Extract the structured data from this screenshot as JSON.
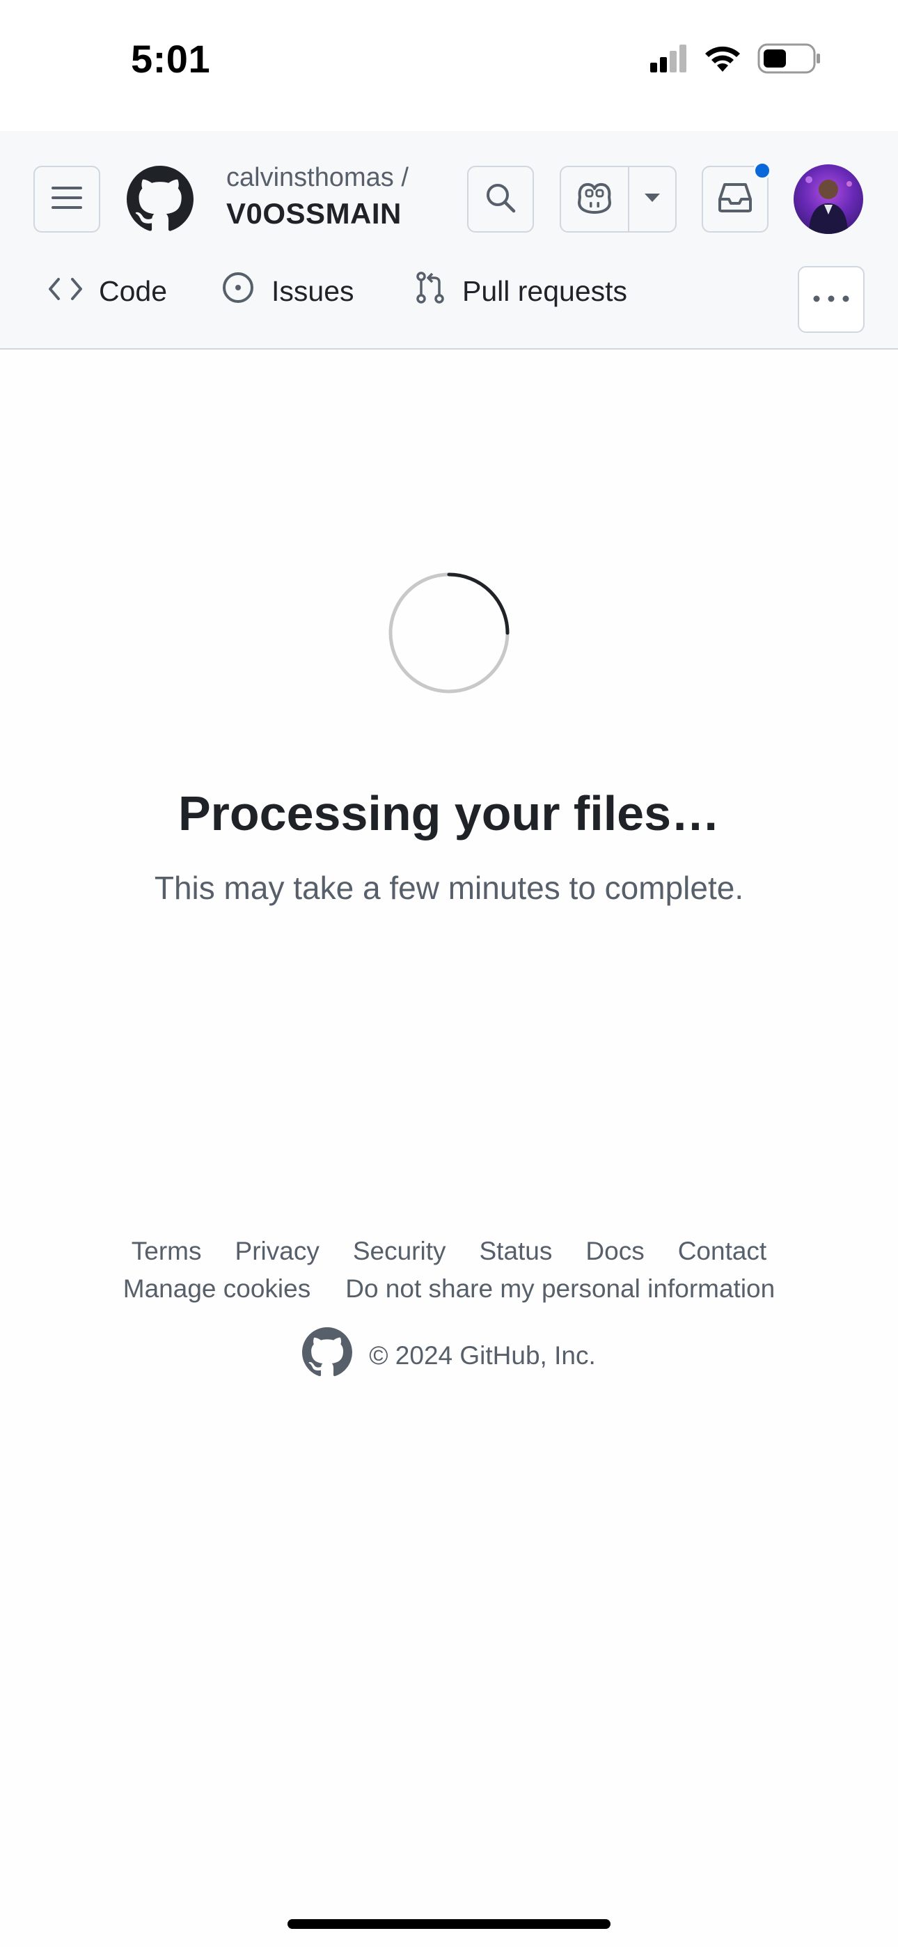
{
  "status_bar": {
    "time": "5:01",
    "icons": [
      "cellular-signal-icon",
      "wifi-icon",
      "battery-icon"
    ]
  },
  "header": {
    "owner": "calvinsthomas /",
    "repo": "V0OSSMAIN",
    "icons": [
      "hamburger-menu-icon",
      "github-logo-icon",
      "search-icon",
      "copilot-icon",
      "triangle-down-icon",
      "inbox-icon",
      "avatar"
    ],
    "notification_dot_color": "#0969da"
  },
  "nav": {
    "tabs": [
      {
        "label": "Code",
        "icon": "code-icon"
      },
      {
        "label": "Issues",
        "icon": "issue-opened-icon"
      },
      {
        "label": "Pull requests",
        "icon": "git-pull-request-icon"
      }
    ],
    "more_icon": "kebab-horizontal-icon"
  },
  "main": {
    "title": "Processing your files…",
    "subtitle": "This may take a few minutes to complete.",
    "spinner_icon": "loading-spinner-icon"
  },
  "footer": {
    "links_row1": [
      "Terms",
      "Privacy",
      "Security",
      "Status",
      "Docs",
      "Contact"
    ],
    "links_row2": [
      "Manage cookies",
      "Do not share my personal information"
    ],
    "copyright": "© 2024 GitHub, Inc."
  },
  "colors": {
    "header_bg": "#f6f8fa",
    "border": "#d0d7de",
    "text_primary": "#1f2328",
    "text_muted": "#57606a",
    "accent": "#0969da"
  }
}
